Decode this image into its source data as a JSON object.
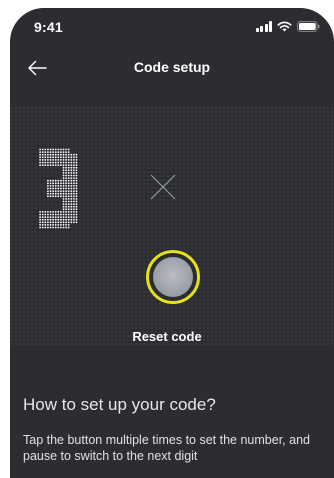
{
  "status_bar": {
    "time": "9:41",
    "icons": [
      "signal-icon",
      "wifi-icon",
      "battery-icon"
    ]
  },
  "header": {
    "back_icon": "arrow-left-icon",
    "title": "Code setup"
  },
  "code": {
    "digits": [
      "3",
      ""
    ],
    "placeholder_icon": "x-icon"
  },
  "reset": {
    "label": "Reset code",
    "ring_color": "#e8e01b"
  },
  "instructions": {
    "title": "How to set up your code?",
    "body": "Tap the button multiple times to set the number, and pause to switch to the next digit"
  },
  "colors": {
    "background": "#2b2d31",
    "dot_grid": "#3b3d42",
    "accent": "#e8e01b",
    "text": "#ffffff"
  }
}
